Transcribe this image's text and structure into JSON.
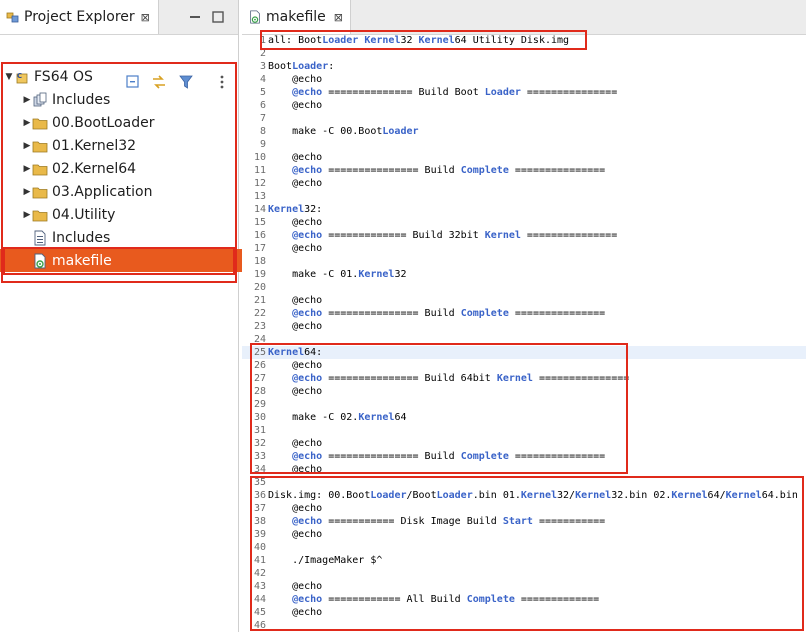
{
  "project_explorer": {
    "tab_label": "Project Explorer",
    "tab_close": "⊠",
    "tree": [
      {
        "label": "FS64 OS",
        "expanded": true,
        "level": 0,
        "icon": "c-project-icon"
      },
      {
        "label": "Includes",
        "level": 1,
        "icon": "includes-icon"
      },
      {
        "label": "00.BootLoader",
        "level": 1,
        "icon": "folder-icon"
      },
      {
        "label": "01.Kernel32",
        "level": 1,
        "icon": "folder-icon"
      },
      {
        "label": "02.Kernel64",
        "level": 1,
        "icon": "folder-icon"
      },
      {
        "label": "03.Application",
        "level": 1,
        "icon": "folder-icon"
      },
      {
        "label": "04.Utility",
        "level": 1,
        "icon": "folder-icon"
      },
      {
        "label": "Includes",
        "level": 1,
        "icon": "file-icon"
      },
      {
        "label": "makefile",
        "level": 1,
        "icon": "makefile-icon",
        "selected": true
      }
    ]
  },
  "editor": {
    "tab_label": "makefile",
    "tab_close": "⊠",
    "lines": [
      "all: BootLoader Kernel32 Kernel64 Utility Disk.img",
      "",
      "BootLoader:",
      "\t@echo",
      "\t@echo ============== Build Boot Loader ===============",
      "\t@echo",
      "",
      "\tmake -C 00.BootLoader",
      "",
      "\t@echo",
      "\t@echo =============== Build Complete ===============",
      "\t@echo",
      "",
      "Kernel32:",
      "\t@echo",
      "\t@echo ============= Build 32bit Kernel ===============",
      "\t@echo",
      "",
      "\tmake -C 01.Kernel32",
      "",
      "\t@echo",
      "\t@echo =============== Build Complete ===============",
      "\t@echo",
      "",
      "Kernel64:",
      "\t@echo",
      "\t@echo =============== Build 64bit Kernel ===============",
      "\t@echo",
      "",
      "\tmake -C 02.Kernel64",
      "",
      "\t@echo",
      "\t@echo =============== Build Complete ===============",
      "\t@echo",
      "",
      "Disk.img: 00.BootLoader/BootLoader.bin 01.Kernel32/Kernel32.bin 02.Kernel64/Kernel64.bin",
      "\t@echo",
      "\t@echo =========== Disk Image Build Start ===========",
      "\t@echo",
      "",
      "\t./ImageMaker $^",
      "",
      "\t@echo",
      "\t@echo ============ All Build Complete =============",
      "\t@echo",
      ""
    ],
    "keywords": [
      "@echo",
      "Loader",
      "Complete",
      "Kernel",
      "Start"
    ],
    "current_line": 24
  },
  "colors": {
    "annotation": "#e02a1b",
    "selection": "#e85a1e",
    "keyword": "#3a63c8"
  }
}
